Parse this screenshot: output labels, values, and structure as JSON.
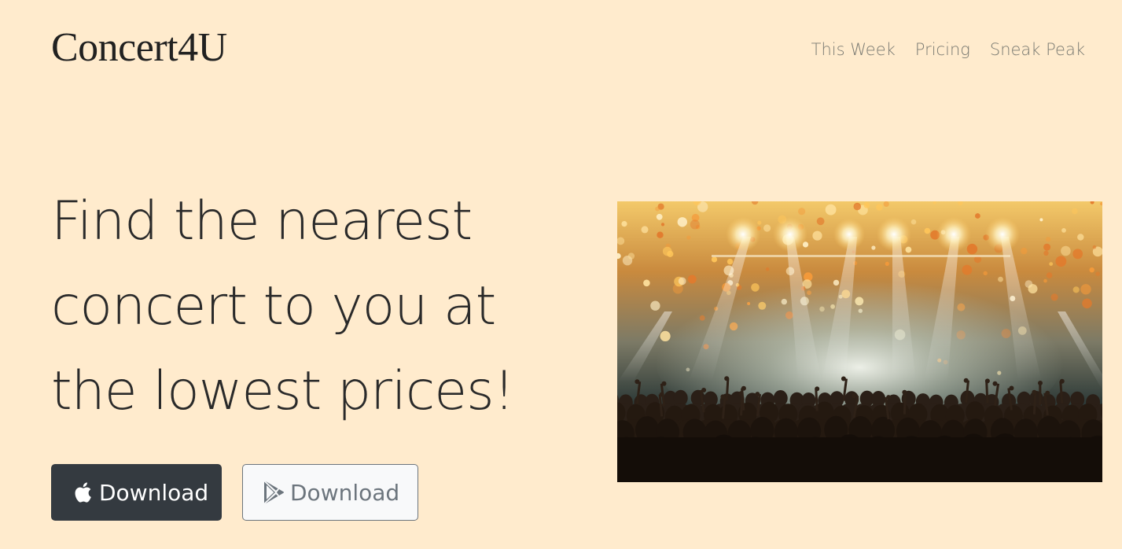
{
  "brand": {
    "name": "Concert4U"
  },
  "nav": {
    "items": [
      {
        "label": "This Week"
      },
      {
        "label": "Pricing"
      },
      {
        "label": "Sneak Peak"
      }
    ]
  },
  "hero": {
    "headline": "Find the nearest concert to you at the lowest prices!",
    "buttons": {
      "apple": {
        "label": "Download",
        "icon": "apple-icon"
      },
      "google": {
        "label": "Download",
        "icon": "google-play-icon"
      }
    },
    "image": {
      "description_icon": "concert-crowd-image"
    }
  },
  "colors": {
    "background": "#FFEBCD",
    "dark_button": "#343a40",
    "light_button": "#f8f9fa",
    "muted_text": "#6c757d"
  }
}
